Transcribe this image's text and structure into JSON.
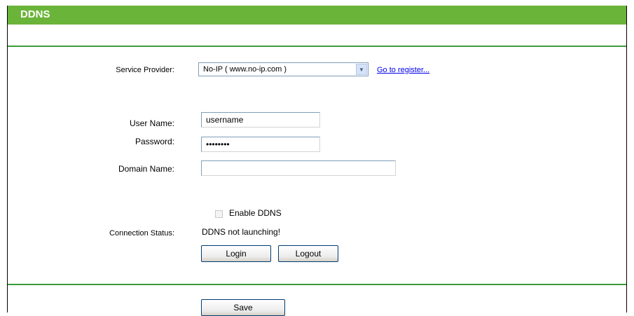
{
  "header": {
    "title": "DDNS"
  },
  "form": {
    "service_provider_label": "Service Provider:",
    "service_provider_value": "No-IP ( www.no-ip.com )",
    "go_register_link": "Go to register...",
    "username_label": "User Name:",
    "username_value": "username",
    "password_label": "Password:",
    "password_value": "********",
    "domain_label": "Domain Name:",
    "domain_value": "",
    "enable_ddns_label": "Enable DDNS",
    "enable_ddns_checked": false,
    "connection_status_label": "Connection Status:",
    "connection_status_value": "DDNS not launching!",
    "login_button": "Login",
    "logout_button": "Logout",
    "save_button": "Save"
  },
  "colors": {
    "header_bg": "#6bb43a",
    "rule": "#3c9b3c",
    "link": "#0000ee"
  }
}
